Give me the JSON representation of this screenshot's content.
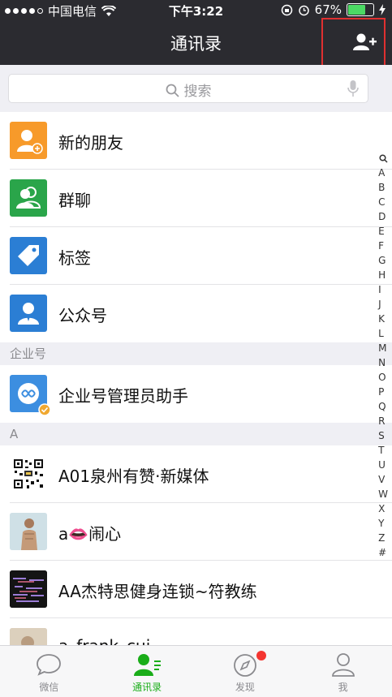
{
  "status_bar": {
    "carrier": "中国电信",
    "time": "下午3:22",
    "battery": "67%",
    "battery_level": 0.67
  },
  "nav": {
    "title": "通讯录"
  },
  "search": {
    "placeholder": "搜索"
  },
  "top_items": [
    {
      "label": "新的朋友",
      "icon": "new-friend-icon",
      "color": "#f79a2a"
    },
    {
      "label": "群聊",
      "icon": "group-chat-icon",
      "color": "#2aa54a"
    },
    {
      "label": "标签",
      "icon": "tag-icon",
      "color": "#2b7ed4"
    },
    {
      "label": "公众号",
      "icon": "official-account-icon",
      "color": "#2b7ed4"
    }
  ],
  "sections": [
    {
      "header": "企业号",
      "items": [
        {
          "label": "企业号管理员助手"
        }
      ]
    },
    {
      "header": "A",
      "items": [
        {
          "label": "A01泉州有赞·新媒体"
        },
        {
          "label": "a👄闹心"
        },
        {
          "label": "AA杰特思健身连锁~符教练"
        },
        {
          "label": "a_frank_cui"
        }
      ]
    }
  ],
  "index_letters": [
    "A",
    "B",
    "C",
    "D",
    "E",
    "F",
    "G",
    "H",
    "I",
    "J",
    "K",
    "L",
    "M",
    "N",
    "O",
    "P",
    "Q",
    "R",
    "S",
    "T",
    "U",
    "V",
    "W",
    "X",
    "Y",
    "Z",
    "#"
  ],
  "tabs": [
    {
      "label": "微信",
      "icon": "chat-icon",
      "active": false
    },
    {
      "label": "通讯录",
      "icon": "contacts-icon",
      "active": true
    },
    {
      "label": "发现",
      "icon": "compass-icon",
      "active": false,
      "badge": true
    },
    {
      "label": "我",
      "icon": "profile-icon",
      "active": false
    }
  ],
  "colors": {
    "accent": "#1aad19",
    "nav_bg": "#2b2b30",
    "badge": "#f43530",
    "highlight": "#e03030"
  }
}
